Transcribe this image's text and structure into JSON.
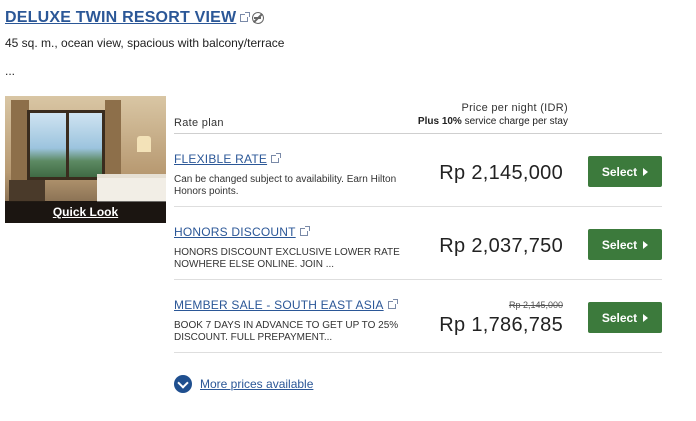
{
  "room": {
    "title": "DELUXE TWIN RESORT VIEW",
    "description": "45 sq. m., ocean view, spacious with balcony/terrace",
    "more": "...",
    "quick_look": "Quick Look"
  },
  "header": {
    "rate_plan": "Rate plan",
    "price_per_night": "Price per night (IDR)",
    "service_plus": "Plus",
    "service_percent": "10%",
    "service_rest": "service charge per stay"
  },
  "rates": [
    {
      "name": "FLEXIBLE RATE",
      "description": "Can be changed subject to availability. Earn Hilton Honors points.",
      "price": "Rp 2,145,000",
      "original_price": "",
      "button": "Select"
    },
    {
      "name": "HONORS DISCOUNT",
      "description": "HONORS DISCOUNT EXCLUSIVE LOWER RATE NOWHERE ELSE ONLINE. JOIN ...",
      "price": "Rp 2,037,750",
      "original_price": "",
      "button": "Select"
    },
    {
      "name": "MEMBER SALE - SOUTH EAST ASIA",
      "description": "BOOK 7 DAYS IN ADVANCE TO GET UP TO 25% DISCOUNT. FULL PREPAYMENT...",
      "price": "Rp 1,786,785",
      "original_price": "Rp 2,145,000",
      "button": "Select"
    }
  ],
  "more_prices": "More prices available",
  "colors": {
    "link": "#2b5797",
    "select_button": "#3c7a3c",
    "more_circle": "#1f4f8f"
  },
  "icons": {
    "external_link": "external-link-icon",
    "no_smoking": "no-smoking-icon",
    "button_arrow": "caret-right-icon",
    "expand": "chevron-down-icon"
  }
}
